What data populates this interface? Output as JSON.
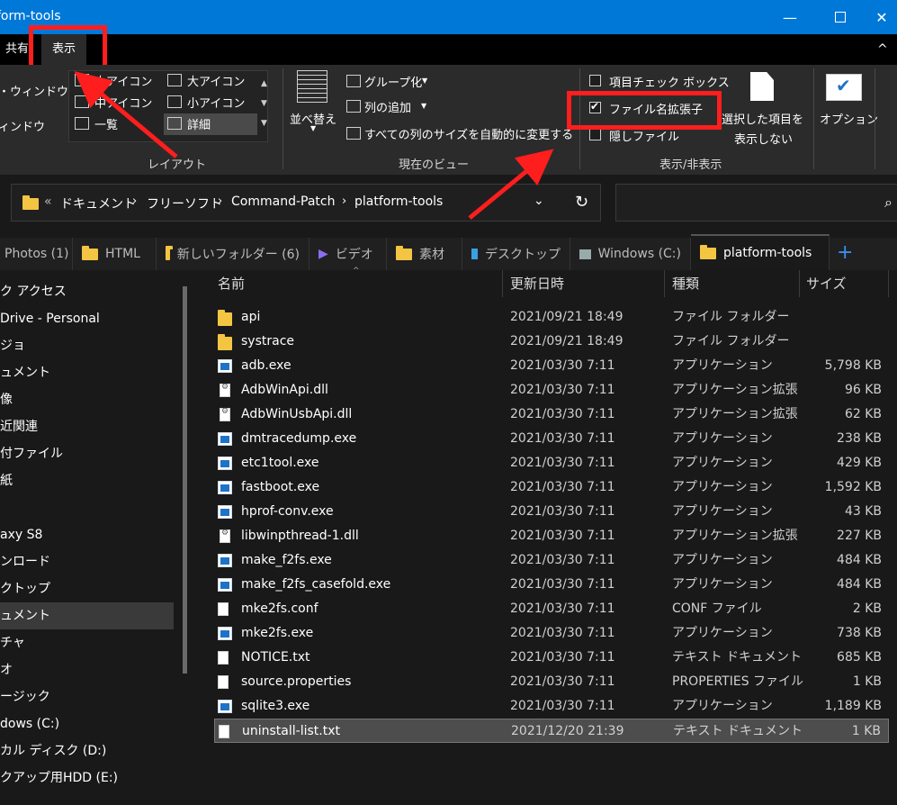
{
  "window": {
    "title": "form-tools"
  },
  "menu": {
    "share": "共有",
    "view": "表示"
  },
  "ribbon": {
    "nav_pane": {
      "line1": "・ウィンドウ",
      "line2": "ィンドウ"
    },
    "layout": {
      "items": [
        "大アイコン",
        "大アイコン",
        "中アイコン",
        "小アイコン",
        "一覧",
        "詳細"
      ],
      "group": "レイアウト"
    },
    "current_view": {
      "sort": "並べ替え",
      "group_by": "グループ化",
      "add_column": "列の追加",
      "autosize": "すべての列のサイズを自動的に変更する",
      "group": "現在のビュー"
    },
    "show_hide": {
      "item_checkbox": "項目チェック ボックス",
      "file_ext": "ファイル名拡張子",
      "hidden": "隠しファイル",
      "hide_selected_1": "選択した項目を",
      "hide_selected_2": "表示しない",
      "group": "表示/非表示"
    },
    "options": "オプション"
  },
  "address": {
    "crumbs": [
      "«",
      "ドキュメント",
      "フリーソフト",
      "Command-Patch",
      "platform-tools"
    ]
  },
  "tabs": [
    {
      "label": "Photos (1)"
    },
    {
      "label": "HTML"
    },
    {
      "label": "新しいフォルダー (6)"
    },
    {
      "label": "ビデオ"
    },
    {
      "label": "素材"
    },
    {
      "label": "デスクトップ"
    },
    {
      "label": "Windows (C:)"
    },
    {
      "label": "platform-tools"
    }
  ],
  "nav": [
    "ク アクセス",
    "Drive - Personal",
    "ジョ",
    "ュメント",
    "像",
    "近関連",
    "付ファイル",
    "紙",
    "",
    "axy S8",
    "ンロード",
    "クトップ",
    "ュメント",
    "チャ",
    "オ",
    "ージック",
    "dows (C:)",
    "カル ディスク (D:)",
    "クアップ用HDD (E:)"
  ],
  "columns": {
    "name": "名前",
    "date": "更新日時",
    "type": "種類",
    "size": "サイズ"
  },
  "files": [
    {
      "name": "api",
      "date": "2021/09/21 18:49",
      "type": "ファイル フォルダー",
      "size": "",
      "icon": "folder"
    },
    {
      "name": "systrace",
      "date": "2021/09/21 18:49",
      "type": "ファイル フォルダー",
      "size": "",
      "icon": "folder"
    },
    {
      "name": "adb.exe",
      "date": "2021/03/30 7:11",
      "type": "アプリケーション",
      "size": "5,798 KB",
      "icon": "exe"
    },
    {
      "name": "AdbWinApi.dll",
      "date": "2021/03/30 7:11",
      "type": "アプリケーション拡張",
      "size": "96 KB",
      "icon": "dll"
    },
    {
      "name": "AdbWinUsbApi.dll",
      "date": "2021/03/30 7:11",
      "type": "アプリケーション拡張",
      "size": "62 KB",
      "icon": "dll"
    },
    {
      "name": "dmtracedump.exe",
      "date": "2021/03/30 7:11",
      "type": "アプリケーション",
      "size": "238 KB",
      "icon": "exe"
    },
    {
      "name": "etc1tool.exe",
      "date": "2021/03/30 7:11",
      "type": "アプリケーション",
      "size": "429 KB",
      "icon": "exe"
    },
    {
      "name": "fastboot.exe",
      "date": "2021/03/30 7:11",
      "type": "アプリケーション",
      "size": "1,592 KB",
      "icon": "exe"
    },
    {
      "name": "hprof-conv.exe",
      "date": "2021/03/30 7:11",
      "type": "アプリケーション",
      "size": "43 KB",
      "icon": "exe"
    },
    {
      "name": "libwinpthread-1.dll",
      "date": "2021/03/30 7:11",
      "type": "アプリケーション拡張",
      "size": "227 KB",
      "icon": "dll"
    },
    {
      "name": "make_f2fs.exe",
      "date": "2021/03/30 7:11",
      "type": "アプリケーション",
      "size": "484 KB",
      "icon": "exe"
    },
    {
      "name": "make_f2fs_casefold.exe",
      "date": "2021/03/30 7:11",
      "type": "アプリケーション",
      "size": "484 KB",
      "icon": "exe"
    },
    {
      "name": "mke2fs.conf",
      "date": "2021/03/30 7:11",
      "type": "CONF ファイル",
      "size": "2 KB",
      "icon": "file"
    },
    {
      "name": "mke2fs.exe",
      "date": "2021/03/30 7:11",
      "type": "アプリケーション",
      "size": "738 KB",
      "icon": "exe"
    },
    {
      "name": "NOTICE.txt",
      "date": "2021/03/30 7:11",
      "type": "テキスト ドキュメント",
      "size": "685 KB",
      "icon": "file"
    },
    {
      "name": "source.properties",
      "date": "2021/03/30 7:11",
      "type": "PROPERTIES ファイル",
      "size": "1 KB",
      "icon": "file"
    },
    {
      "name": "sqlite3.exe",
      "date": "2021/03/30 7:11",
      "type": "アプリケーション",
      "size": "1,189 KB",
      "icon": "exe"
    },
    {
      "name": "uninstall-list.txt",
      "date": "2021/12/20 21:39",
      "type": "テキスト ドキュメント",
      "size": "1 KB",
      "icon": "file",
      "selected": true
    }
  ],
  "colors": {
    "titlebar": "#0078d7",
    "ribbon": "#2b2b2b",
    "background": "#191919",
    "annotation": "#ff1e1e",
    "folder": "#f3c542"
  }
}
